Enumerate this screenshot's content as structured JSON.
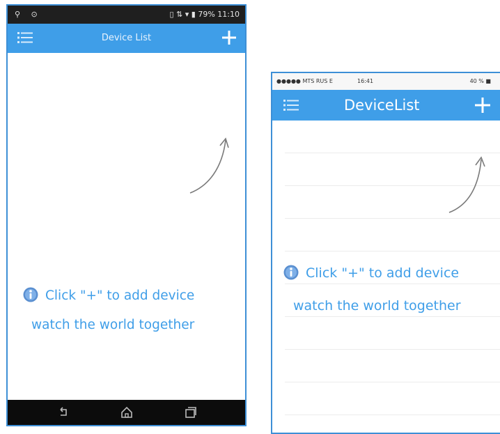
{
  "android": {
    "statusbar": {
      "left_icons": "⚲ ⊙",
      "right_text": "▯ ⇅ ▾ ▮ 79% 11:10"
    },
    "navbar": {
      "title": "Device List"
    },
    "hint": {
      "line1": "Click \"+\" to add device",
      "line2": "watch the world together"
    }
  },
  "iphone": {
    "statusbar": {
      "carrier": "●●●●● MTS RUS E",
      "time": "16:41",
      "battery": "40 % ■"
    },
    "navbar": {
      "title": "DeviceList"
    },
    "hint": {
      "line1": "Click \"+\" to add device",
      "line2": "watch the world together"
    }
  },
  "colors": {
    "accent": "#3f9ee8",
    "border": "#3d8fd6"
  },
  "icons": [
    "menu-icon",
    "add-icon",
    "info-icon",
    "curved-arrow-icon",
    "back-icon",
    "home-icon",
    "recents-icon"
  ]
}
